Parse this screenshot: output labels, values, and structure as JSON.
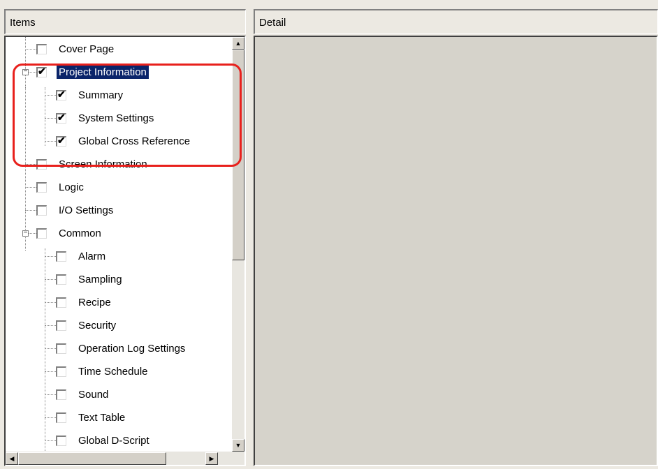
{
  "items_panel": {
    "header": "Items"
  },
  "detail_panel": {
    "header": "Detail"
  },
  "tree": [
    {
      "label": "Cover Page",
      "checked": false,
      "level": 0
    },
    {
      "label": "Project Information",
      "checked": true,
      "level": 0,
      "expander": "−",
      "selected": true
    },
    {
      "label": "Summary",
      "checked": true,
      "level": 1
    },
    {
      "label": "System Settings",
      "checked": true,
      "level": 1
    },
    {
      "label": "Global Cross Reference",
      "checked": true,
      "level": 1
    },
    {
      "label": "Screen Information",
      "checked": false,
      "level": 0
    },
    {
      "label": "Logic",
      "checked": false,
      "level": 0
    },
    {
      "label": "I/O Settings",
      "checked": false,
      "level": 0
    },
    {
      "label": "Common",
      "checked": false,
      "level": 0,
      "expander": "−"
    },
    {
      "label": "Alarm",
      "checked": false,
      "level": 1
    },
    {
      "label": "Sampling",
      "checked": false,
      "level": 1
    },
    {
      "label": "Recipe",
      "checked": false,
      "level": 1
    },
    {
      "label": "Security",
      "checked": false,
      "level": 1
    },
    {
      "label": "Operation Log Settings",
      "checked": false,
      "level": 1
    },
    {
      "label": "Time Schedule",
      "checked": false,
      "level": 1
    },
    {
      "label": "Sound",
      "checked": false,
      "level": 1
    },
    {
      "label": "Text Table",
      "checked": false,
      "level": 1
    },
    {
      "label": "Global D-Script",
      "checked": false,
      "level": 1
    }
  ],
  "checkmark": "✔",
  "scroll_arrows": {
    "up": "▲",
    "down": "▼",
    "left": "◀",
    "right": "▶"
  },
  "colors": {
    "selection": "#0a246a",
    "highlight_border": "#e8201c"
  }
}
